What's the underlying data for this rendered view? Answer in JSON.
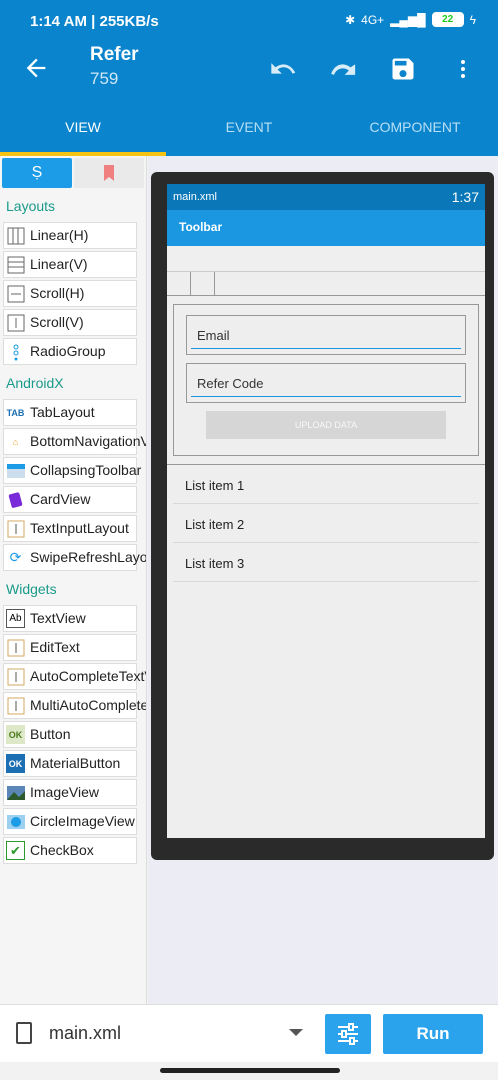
{
  "status_bar": {
    "time": "1:14 AM | 255KB/s",
    "battery": "22",
    "network": "4G+"
  },
  "app_bar": {
    "title": "Refer",
    "subtitle": "759"
  },
  "tabs": [
    {
      "label": "VIEW",
      "active": true
    },
    {
      "label": "EVENT",
      "active": false
    },
    {
      "label": "COMPONENT",
      "active": false
    }
  ],
  "palette": {
    "layouts_header": "Layouts",
    "layouts": [
      "Linear(H)",
      "Linear(V)",
      "Scroll(H)",
      "Scroll(V)",
      "RadioGroup"
    ],
    "androidx_header": "AndroidX",
    "androidx": [
      "TabLayout",
      "BottomNavigationView",
      "CollapsingToolbar",
      "CardView",
      "TextInputLayout",
      "SwipeRefreshLayout"
    ],
    "widgets_header": "Widgets",
    "widgets": [
      "TextView",
      "EditText",
      "AutoCompleteTextView",
      "MultiAutoCompleteTextView",
      "Button",
      "MaterialButton",
      "ImageView",
      "CircleImageView",
      "CheckBox"
    ]
  },
  "device": {
    "filename": "main.xml",
    "time": "1:37",
    "toolbar": "Toolbar",
    "email_hint": "Email",
    "refer_hint": "Refer Code",
    "upload_label": "UPLOAD DATA",
    "list_items": [
      "List item 1",
      "List item 2",
      "List item 3"
    ]
  },
  "bottom": {
    "file": "main.xml",
    "run_label": "Run"
  },
  "colors": {
    "primary": "#0a84cc",
    "accent": "#f5c314",
    "button": "#2ba3ec"
  }
}
